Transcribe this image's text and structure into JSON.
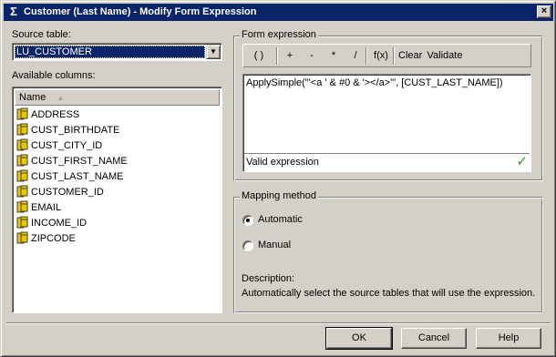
{
  "window": {
    "title": "Customer (Last Name) - Modify Form Expression",
    "title_icon_glyph": "Σ",
    "close_glyph": "×"
  },
  "source_table": {
    "label": "Source table:",
    "value": "LU_CUSTOMER"
  },
  "available_columns": {
    "label": "Available columns:",
    "header": "Name",
    "items": [
      {
        "label": "ADDRESS"
      },
      {
        "label": "CUST_BIRTHDATE"
      },
      {
        "label": "CUST_CITY_ID"
      },
      {
        "label": "CUST_FIRST_NAME"
      },
      {
        "label": "CUST_LAST_NAME"
      },
      {
        "label": "CUSTOMER_ID"
      },
      {
        "label": "EMAIL"
      },
      {
        "label": "INCOME_ID"
      },
      {
        "label": "ZIPCODE"
      }
    ]
  },
  "form_expression": {
    "title": "Form expression",
    "toolbar": {
      "parens": "( )",
      "plus": "+",
      "minus": "-",
      "multiply": "*",
      "divide": "/",
      "fx": "f(x)",
      "clear": "Clear",
      "validate": "Validate"
    },
    "expression": "ApplySimple(\"'<a ' & #0 & '></a>'\", [CUST_LAST_NAME])",
    "status": "Valid expression"
  },
  "mapping": {
    "title": "Mapping method",
    "automatic": "Automatic",
    "manual": "Manual",
    "selected": "Automatic",
    "description_label": "Description:",
    "description_text": "Automatically select the source tables that will use the expression."
  },
  "buttons": {
    "ok": "OK",
    "cancel": "Cancel",
    "help": "Help"
  },
  "colors": {
    "title_bar": "#0a246a",
    "dialog_bg": "#d4d0c8",
    "selection": "#0a246a",
    "valid_check": "#2a9a2a",
    "column_icon": "#e8c800"
  },
  "icons": {
    "column": "column-icon",
    "check": "check-icon"
  }
}
